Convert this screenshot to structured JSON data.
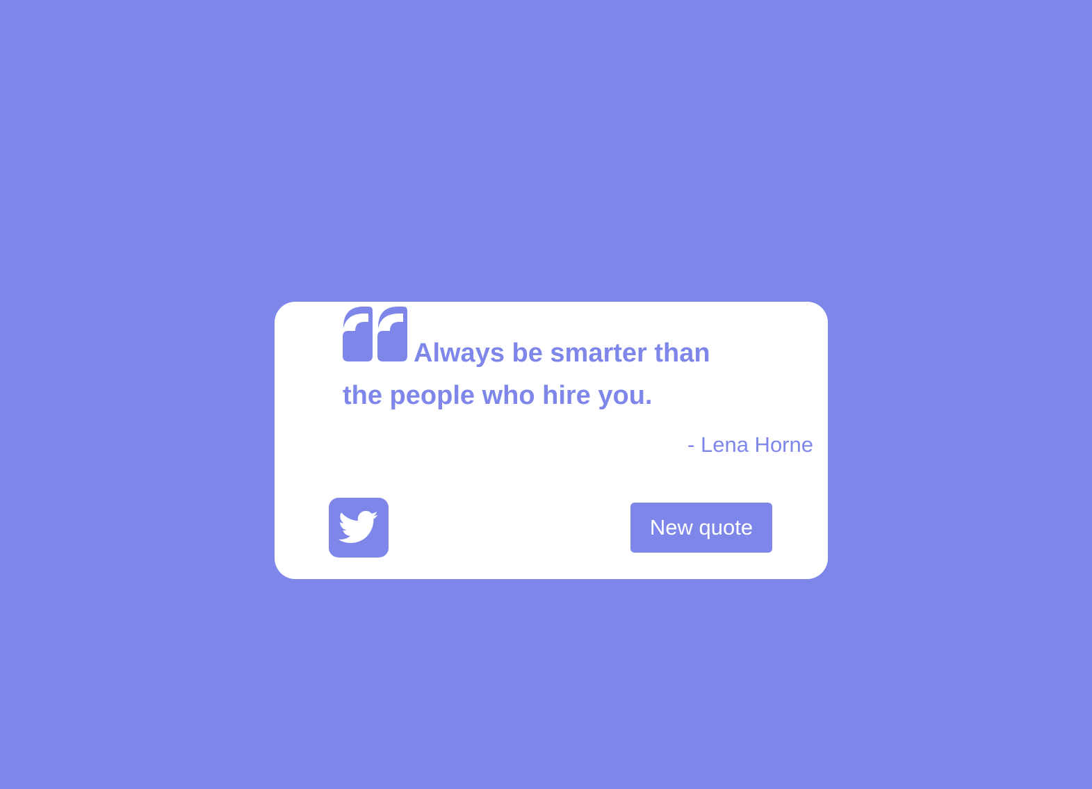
{
  "colors": {
    "background": "#7f86ea",
    "card": "#ffffff",
    "accent": "#7f86ea"
  },
  "quote": {
    "icon": "quote-left-icon",
    "text": "Always be smarter than the people who hire you.",
    "author": "- Lena Horne"
  },
  "actions": {
    "tweet_icon": "twitter-icon",
    "new_quote_label": "New quote"
  }
}
